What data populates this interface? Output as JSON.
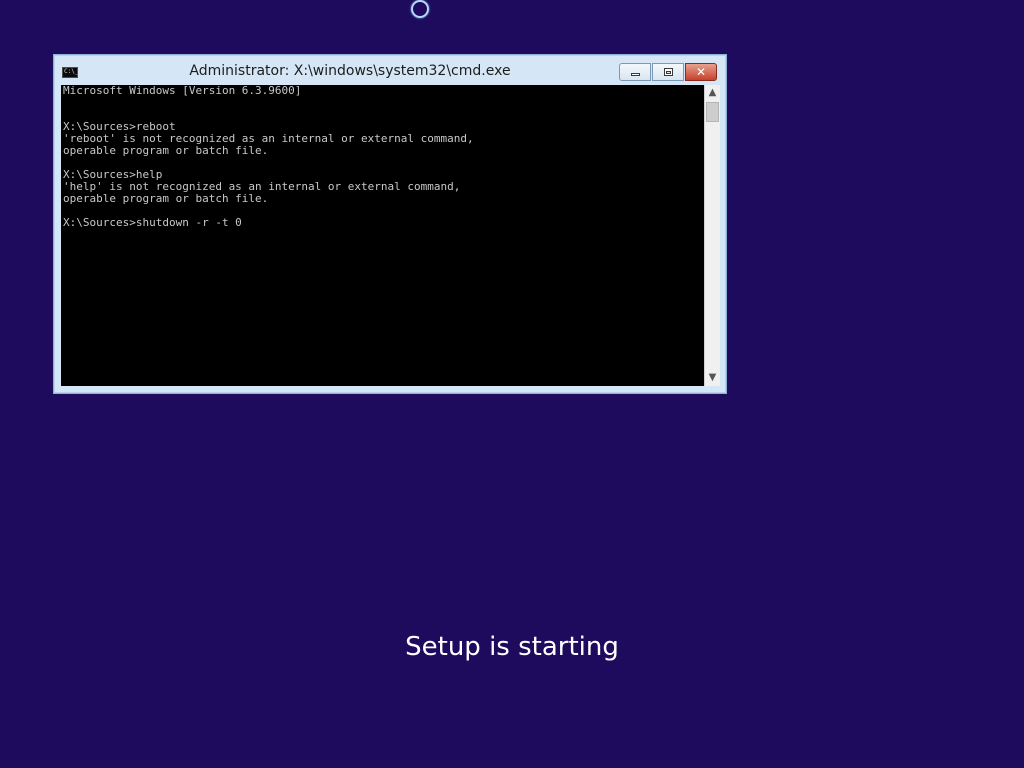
{
  "colors": {
    "background": "#1e0b5e",
    "console_bg": "#000000",
    "console_fg": "#c8c8c8",
    "window_frame": "#d5e7f6",
    "close_button": "#c6412c"
  },
  "loading_indicator": {
    "icon": "spinner-icon"
  },
  "cmd_window": {
    "title": "Administrator: X:\\windows\\system32\\cmd.exe",
    "icon": "cmd-icon",
    "icon_text": "C:\\_",
    "buttons": {
      "minimize": "minimize-icon",
      "maximize": "maximize-icon",
      "close": "close-icon",
      "close_glyph": "✕"
    },
    "console_lines": [
      "Microsoft Windows [Version 6.3.9600]",
      "",
      "",
      "X:\\Sources>reboot",
      "'reboot' is not recognized as an internal or external command,",
      "operable program or batch file.",
      "",
      "X:\\Sources>help",
      "'help' is not recognized as an internal or external command,",
      "operable program or batch file.",
      "",
      "X:\\Sources>shutdown -r -t 0"
    ],
    "scrollbar": {
      "up_glyph": "▲",
      "down_glyph": "▼"
    }
  },
  "status": {
    "message": "Setup is starting"
  }
}
